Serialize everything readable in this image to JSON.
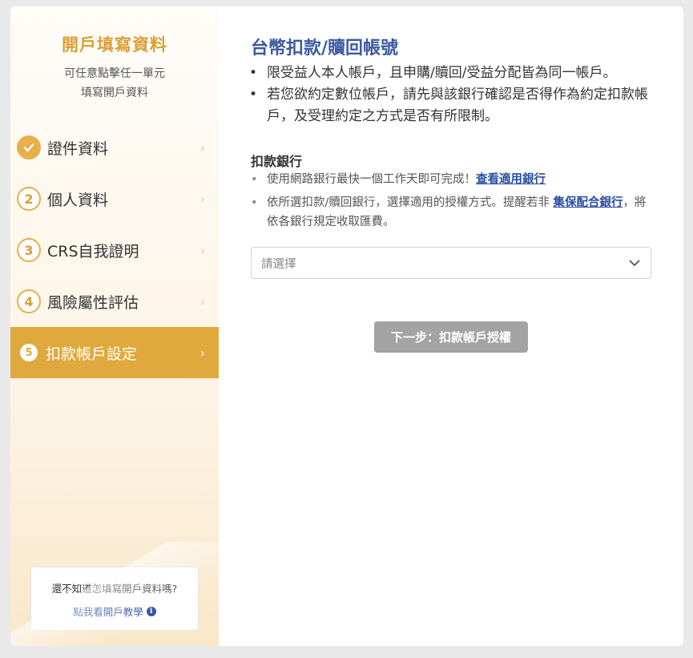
{
  "sidebar": {
    "title": "開戶填寫資料",
    "subtitle_line1": "可任意點擊任一單元",
    "subtitle_line2": "填寫開戶資料",
    "steps": [
      {
        "num": "",
        "label": "證件資料",
        "status": "done"
      },
      {
        "num": "2",
        "label": "個人資料",
        "status": "pending"
      },
      {
        "num": "3",
        "label": "CRS自我證明",
        "status": "pending"
      },
      {
        "num": "4",
        "label": "風險屬性評估",
        "status": "pending"
      },
      {
        "num": "5",
        "label": "扣款帳戶設定",
        "status": "active"
      }
    ],
    "help": {
      "question": "還不知道怎填寫開戶資料嗎?",
      "link": "點我看開戶教學",
      "info_glyph": "i"
    }
  },
  "main": {
    "title": "台幣扣款/贖回帳號",
    "bullets": [
      "限受益人本人帳戶，且申購/贖回/受益分配皆為同一帳戶。",
      "若您欲約定數位帳戶，請先與該銀行確認是否得作為約定扣款帳戶，及受理約定之方式是否有所限制。"
    ],
    "bank_section_title": "扣款銀行",
    "notes": {
      "note1_text": "使用網路銀行最快一個工作天即可完成！",
      "note1_link": "查看適用銀行",
      "note2_text": "依所選扣款/贖回銀行，選擇適用的授權方式。提醒若非 ",
      "note2_link": "集保配合銀行",
      "note2_tail": "，將依各銀行規定收取匯費。"
    },
    "bank_select_placeholder": "請選擇",
    "next_button": "下一步：扣款帳戶授權"
  },
  "colors": {
    "accent_gold": "#e0a93d",
    "title_blue": "#3c5aa2",
    "link_blue": "#2b4fa3",
    "disabled_button": "#a3a3a3"
  },
  "icons": {
    "done_step": "check-icon",
    "chevron": "chevron-right-icon",
    "select_caret": "chevron-down-icon",
    "help_info": "info-icon"
  }
}
